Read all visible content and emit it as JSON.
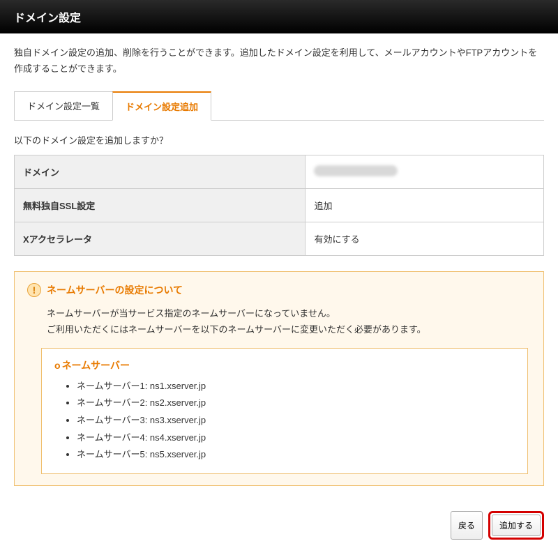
{
  "header": {
    "title": "ドメイン設定"
  },
  "description": "独自ドメイン設定の追加、削除を行うことができます。追加したドメイン設定を利用して、メールアカウントやFTPアカウントを作成することができます。",
  "tabs": [
    {
      "label": "ドメイン設定一覧"
    },
    {
      "label": "ドメイン設定追加"
    }
  ],
  "confirmText": "以下のドメイン設定を追加しますか？",
  "settings": {
    "rows": [
      {
        "label": "ドメイン",
        "value": ""
      },
      {
        "label": "無料独自SSL設定",
        "value": "追加"
      },
      {
        "label": "Xアクセラレータ",
        "value": "有効にする"
      }
    ]
  },
  "notice": {
    "title": "ネームサーバーの設定について",
    "line1": "ネームサーバーが当サービス指定のネームサーバーになっていません。",
    "line2": "ご利用いただくにはネームサーバーを以下のネームサーバーに変更いただく必要があります。",
    "nsTitle": "ネームサーバー",
    "nsList": [
      "ネームサーバー1: ns1.xserver.jp",
      "ネームサーバー2: ns2.xserver.jp",
      "ネームサーバー3: ns3.xserver.jp",
      "ネームサーバー4: ns4.xserver.jp",
      "ネームサーバー5: ns5.xserver.jp"
    ]
  },
  "buttons": {
    "back": "戻る",
    "submit": "追加する"
  }
}
